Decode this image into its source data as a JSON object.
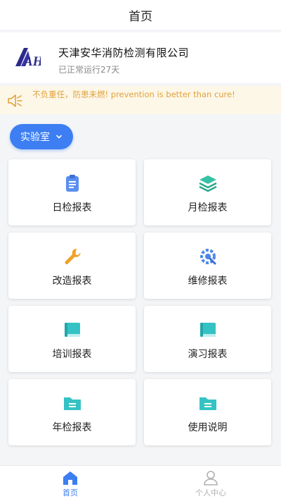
{
  "header": {
    "title": "首页"
  },
  "company": {
    "name": "天津安华消防检测有限公司",
    "status": "已正常运行27天",
    "logo_text": "AH"
  },
  "notice": {
    "text": "不负重任，防患未燃!   prevention is better than cure!"
  },
  "lab_selector": {
    "label": "实验室"
  },
  "cards": [
    {
      "label": "日检报表",
      "icon": "clipboard-icon"
    },
    {
      "label": "月检报表",
      "icon": "layers-icon"
    },
    {
      "label": "改造报表",
      "icon": "wrench-icon"
    },
    {
      "label": "维修报表",
      "icon": "gear-wrench-icon"
    },
    {
      "label": "培训报表",
      "icon": "book-icon"
    },
    {
      "label": "演习报表",
      "icon": "book-icon"
    },
    {
      "label": "年检报表",
      "icon": "folder-icon"
    },
    {
      "label": "使用说明",
      "icon": "folder-icon"
    }
  ],
  "tabbar": {
    "items": [
      {
        "label": "首页",
        "icon": "home-icon",
        "active": true
      },
      {
        "label": "个人中心",
        "icon": "user-icon",
        "active": false
      }
    ]
  },
  "colors": {
    "accent": "#3d7ef2",
    "notice_text": "#e0a23a",
    "notice_bg": "#fdf7e8",
    "teal_icon": "#35c2c4",
    "orange_icon": "#f0a12b"
  }
}
